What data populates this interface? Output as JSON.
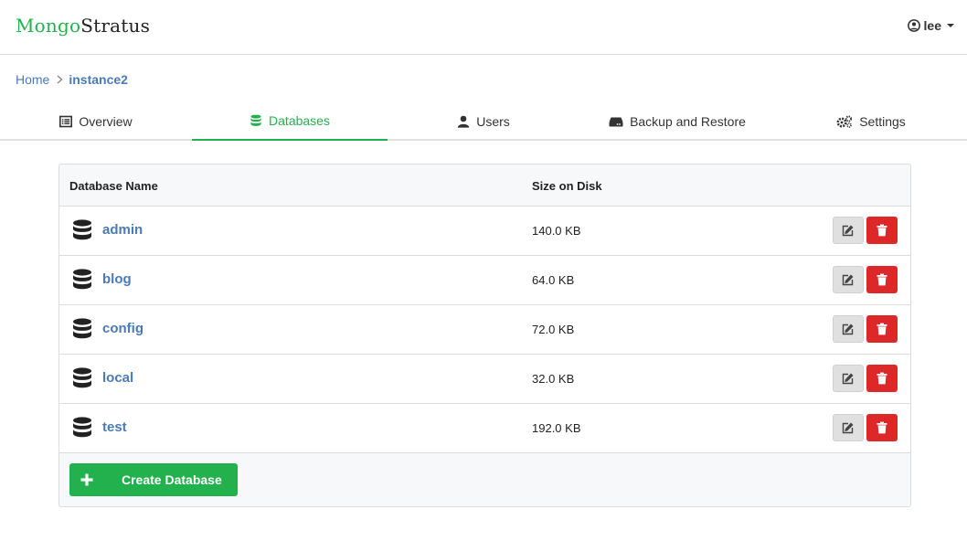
{
  "app": {
    "logo_part1": "Mongo",
    "logo_part2": "Stratus"
  },
  "user": {
    "name": "lee",
    "icon": "user-circle-icon"
  },
  "breadcrumb": {
    "home": "Home",
    "separator": "›",
    "current": "instance2"
  },
  "tabs": [
    {
      "label": "Overview",
      "icon": "list-icon",
      "active": false
    },
    {
      "label": "Databases",
      "icon": "database-icon",
      "active": true
    },
    {
      "label": "Users",
      "icon": "user-icon",
      "active": false
    },
    {
      "label": "Backup and Restore",
      "icon": "hdd-icon",
      "active": false
    },
    {
      "label": "Settings",
      "icon": "gears-icon",
      "active": false
    }
  ],
  "table": {
    "headers": {
      "name": "Database Name",
      "size": "Size on Disk"
    },
    "rows": [
      {
        "name": "admin",
        "size": "140.0 KB"
      },
      {
        "name": "blog",
        "size": "64.0 KB"
      },
      {
        "name": "config",
        "size": "72.0 KB"
      },
      {
        "name": "local",
        "size": "32.0 KB"
      },
      {
        "name": "test",
        "size": "192.0 KB"
      }
    ]
  },
  "actions": {
    "create_label": "Create Database",
    "create_icon": "plus-icon"
  },
  "colors": {
    "accent": "#22b14c",
    "link": "#4a7ab8",
    "danger": "#dc2828"
  }
}
